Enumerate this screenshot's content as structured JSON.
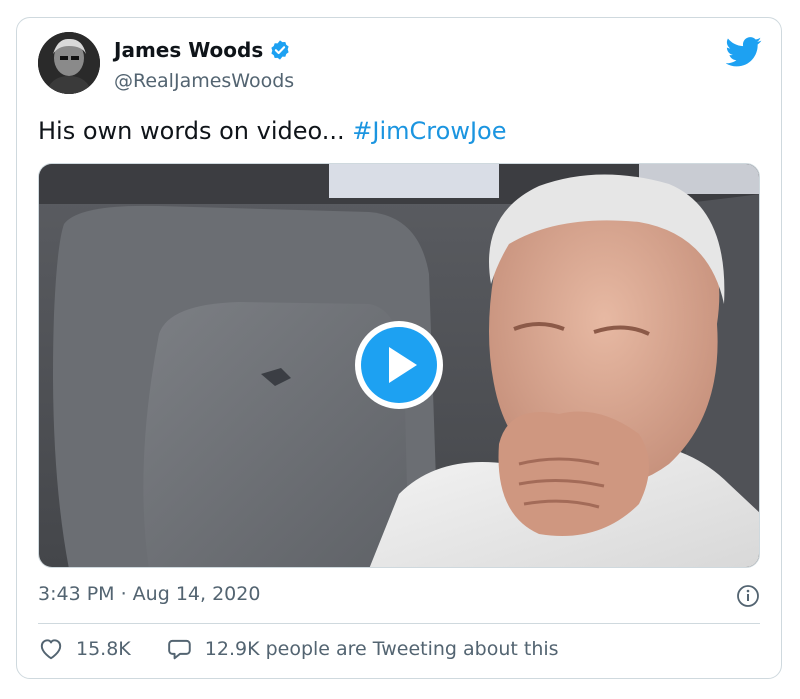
{
  "author": {
    "display_name": "James Woods",
    "handle": "@RealJamesWoods",
    "verified": true,
    "avatar_icon": "avatar-photo"
  },
  "tweet": {
    "text": "His own words on video... ",
    "hashtag": "#JimCrowJoe"
  },
  "media": {
    "type": "video",
    "play_icon": "play-icon"
  },
  "timestamp": "3:43 PM · Aug 14, 2020",
  "actions": {
    "likes": "15.8K",
    "tweeting": "12.9K people are Tweeting about this"
  },
  "colors": {
    "brand": "#1da1f2",
    "hashtag": "#1b95e0",
    "text": "#0f1419",
    "secondary": "#536471",
    "border": "#cfd9de"
  }
}
